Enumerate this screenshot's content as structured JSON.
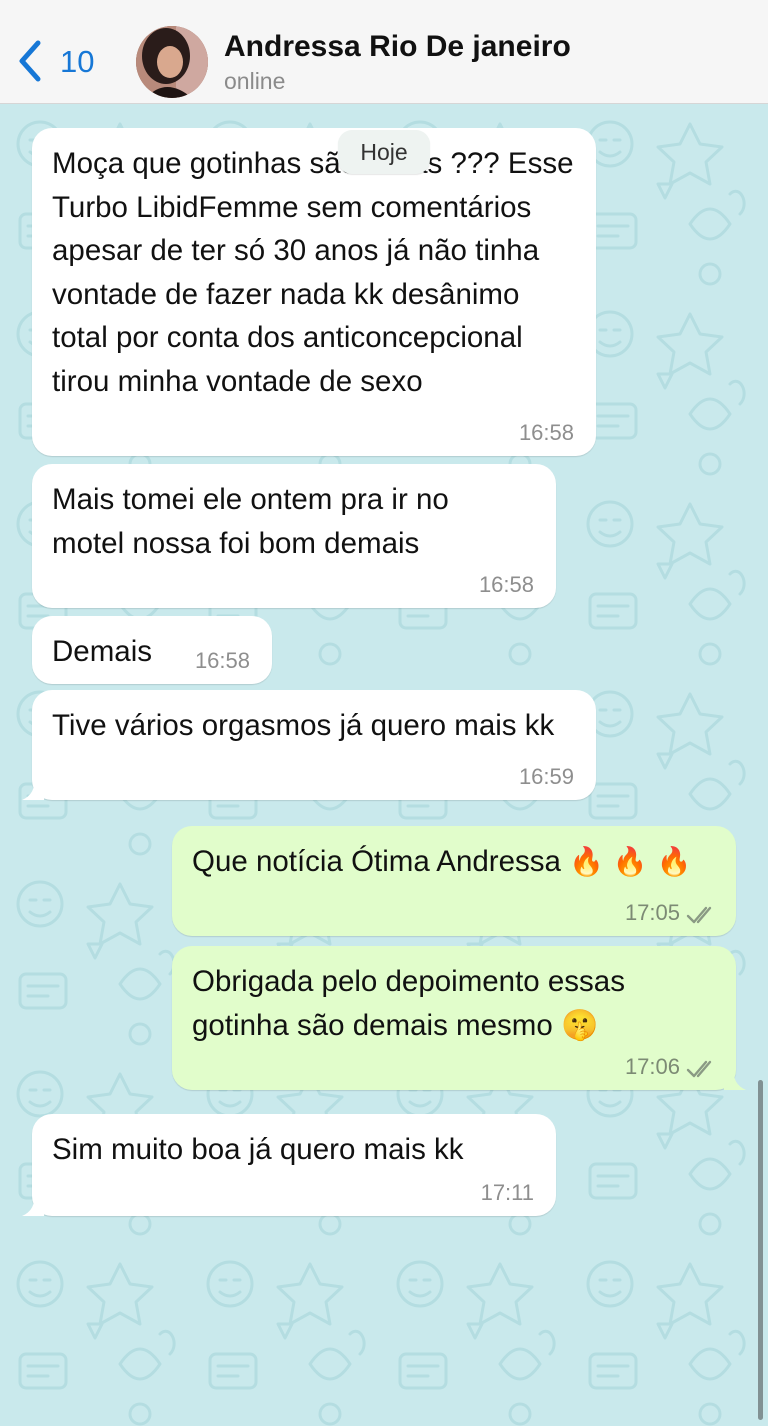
{
  "header": {
    "back_count": "10",
    "contact_name": "Andressa Rio De janeiro",
    "status": "online"
  },
  "chat": {
    "date_label": "Hoje",
    "messages": [
      {
        "dir": "in",
        "text": "Moça que gotinhas são essas ??? Esse Turbo LibidFemme sem comentários apesar de ter só 30 anos já não tinha vontade de fazer nada kk desânimo total por conta dos anticoncepcional tirou minha vontade de sexo",
        "time": "16:58"
      },
      {
        "dir": "in",
        "text": "Mais tomei ele ontem pra ir no motel nossa foi bom demais",
        "time": "16:58"
      },
      {
        "dir": "in",
        "text": "Demais",
        "time": "16:58"
      },
      {
        "dir": "in",
        "text": "Tive vários orgasmos já quero mais kk",
        "time": "16:59"
      },
      {
        "dir": "out",
        "text": "Que notícia Ótima Andressa",
        "emoji": "🔥 🔥 🔥",
        "time": "17:05",
        "read": true
      },
      {
        "dir": "out",
        "text": "Obrigada pelo depoimento essas gotinha são demais mesmo",
        "emoji": "🤫",
        "time": "17:06",
        "read": true
      },
      {
        "dir": "in",
        "text": "Sim muito boa já quero mais kk",
        "time": "17:11"
      }
    ]
  },
  "colors": {
    "accent": "#1677d6",
    "wallpaper": "#c9e9ec",
    "incoming": "#ffffff",
    "outgoing": "#e1fdcb"
  }
}
